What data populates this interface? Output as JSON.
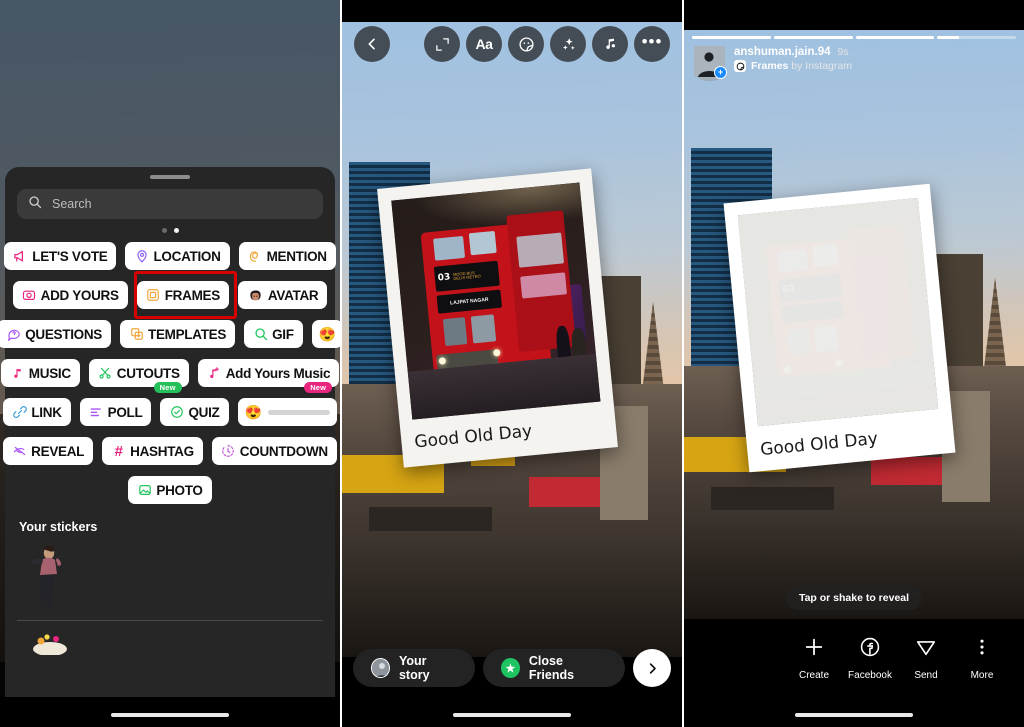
{
  "panels": {
    "left": {
      "name": "instagram-story-sticker-tray",
      "search": {
        "placeholder": "Search",
        "icon": "search-icon"
      },
      "page_dots": {
        "count": 2,
        "active_index": 1
      },
      "sticker_rows": [
        [
          {
            "label": "LET'S VOTE",
            "icon": "megaphone-icon",
            "color": "#e8257f"
          },
          {
            "label": "LOCATION",
            "icon": "location-pin-icon",
            "color": "#8b5cf6"
          },
          {
            "label": "MENTION",
            "icon": "at-mention-icon",
            "color": "#f0a63a"
          }
        ],
        [
          {
            "label": "ADD YOURS",
            "icon": "camera-icon",
            "color": "#e8257f"
          },
          {
            "label": "FRAMES",
            "icon": "frame-square-icon",
            "color": "#f0a63a",
            "highlighted": true
          },
          {
            "label": "AVATAR",
            "icon": "avatar-face-icon",
            "color": "#c98b6b"
          }
        ],
        [
          {
            "label": "QUESTIONS",
            "icon": "question-bubble-icon",
            "color": "#a855f7"
          },
          {
            "label": "TEMPLATES",
            "icon": "templates-icon",
            "color": "#f0a63a"
          },
          {
            "label": "GIF",
            "icon": "gif-search-icon",
            "color": "#22c55e"
          },
          {
            "label": "",
            "icon": "emoji-slider-icon",
            "emoji": "😍"
          }
        ],
        [
          {
            "label": "MUSIC",
            "icon": "music-note-icon",
            "color": "#e8257f"
          },
          {
            "label": "CUTOUTS",
            "icon": "scissors-icon",
            "color": "#22c55e",
            "badge": "New",
            "badge_color": "#25c05a"
          },
          {
            "label": "Add Yours Music",
            "icon": "music-plus-icon",
            "color": "#e8257f",
            "badge": "New",
            "badge_color": "#e8257f"
          }
        ],
        [
          {
            "label": "LINK",
            "icon": "link-chain-icon",
            "color": "#3b9dd8"
          },
          {
            "label": "POLL",
            "icon": "poll-bars-icon",
            "color": "#a855f7"
          },
          {
            "label": "QUIZ",
            "icon": "quiz-check-icon",
            "color": "#22c55e"
          },
          {
            "label": "",
            "icon": "emoji-slider-icon",
            "emoji": "😍"
          }
        ],
        [
          {
            "label": "REVEAL",
            "icon": "reveal-eye-slash-icon",
            "color": "#a855f7"
          },
          {
            "label": "HASHTAG",
            "icon": "hashtag-icon",
            "color": "#e8257f"
          },
          {
            "label": "COUNTDOWN",
            "icon": "countdown-timer-icon",
            "color": "#c05ad8"
          }
        ],
        [
          {
            "label": "PHOTO",
            "icon": "photo-image-icon",
            "color": "#22c55e"
          }
        ]
      ],
      "your_stickers_title": "Your stickers"
    },
    "middle": {
      "name": "instagram-story-editor",
      "toolbar": [
        {
          "icon": "back-chevron-icon",
          "label": "Back"
        },
        {
          "icon": "expand-crop-icon",
          "label": "Resize"
        },
        {
          "icon": "text-aa-icon",
          "label": "Aa"
        },
        {
          "icon": "sticker-smiley-icon",
          "label": "Stickers"
        },
        {
          "icon": "sparkles-effects-icon",
          "label": "Effects"
        },
        {
          "icon": "music-note-icon",
          "label": "Music"
        },
        {
          "icon": "more-horizontal-icon",
          "label": "More"
        }
      ],
      "frame_sticker": {
        "caption": "Good Old Day",
        "revealed": true,
        "photo_alt": "red double-decker bus at night",
        "bus_route_number": "03",
        "bus_destination": "LAJPAT NAGAR",
        "bus_dest_line1": "MOOD BUS",
        "bus_dest_line2": "DELHI METRO"
      },
      "share_bar": {
        "your_story_label": "Your story",
        "close_friends_label": "Close Friends",
        "next_icon": "chevron-right-icon"
      }
    },
    "right": {
      "name": "instagram-story-viewer",
      "progress": {
        "segments": 4,
        "active_index": 3,
        "active_fill_pct": 28
      },
      "header": {
        "username": "anshuman.jain.94",
        "time_ago": "9s",
        "attribution_prefix": "Frames",
        "attribution_suffix": " by Instagram",
        "attribution_icon": "sticker-smiley-icon",
        "avatar_badge": "+"
      },
      "frame_sticker": {
        "caption": "Good Old Day",
        "revealed": false
      },
      "reveal_hint": "Tap or shake to reveal",
      "actions": [
        {
          "label": "Create",
          "icon": "plus-icon"
        },
        {
          "label": "Facebook",
          "icon": "facebook-icon"
        },
        {
          "label": "Send",
          "icon": "send-paper-plane-icon"
        },
        {
          "label": "More",
          "icon": "more-vertical-icon"
        }
      ]
    }
  },
  "colors": {
    "highlight_box": "#d90000",
    "tray_bg": "#262626",
    "chip_bg": "#ffffff",
    "accent_green": "#25c05a",
    "accent_pink": "#e8257f",
    "close_friends_green": "#1fc462"
  }
}
